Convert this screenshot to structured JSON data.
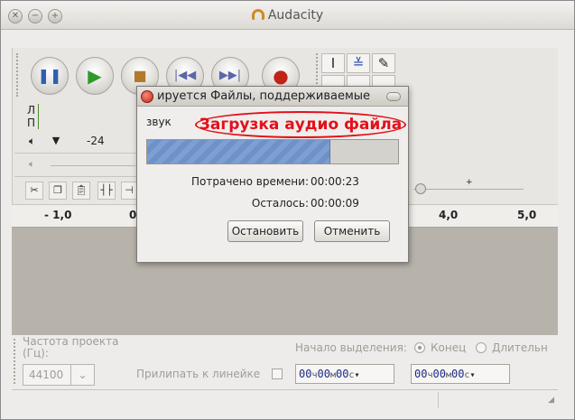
{
  "window": {
    "title": "Audacity"
  },
  "meters": {
    "left_channel": "Л",
    "right_channel": "П",
    "level_label": "-24"
  },
  "ruler": {
    "ticks": [
      "- 1,0",
      "0",
      "4,0",
      "5,0"
    ]
  },
  "bottom": {
    "rate_label": "Частота проекта (Гц):",
    "rate_value": "44100",
    "snap_label": "Прилипать к линейке",
    "selection_start_label": "Начало выделения:",
    "end_option": "Конец",
    "length_option": "Длительн",
    "time1": {
      "h": "00",
      "m": "00",
      "s": "00"
    },
    "time2": {
      "h": "00",
      "m": "00",
      "s": "00"
    },
    "units": {
      "h": "ч",
      "m": "м",
      "s": "с"
    }
  },
  "dialog": {
    "title": "ируется Файлы, поддерживаемые",
    "filename": "звук",
    "annotation": "Загрузка аудио файла",
    "progress": 0.73,
    "elapsed_label": "Потрачено времени:",
    "elapsed_value": "00:00:23",
    "remaining_label": "Осталось:",
    "remaining_value": "00:00:09",
    "stop_label": "Остановить",
    "cancel_label": "Отменить"
  }
}
